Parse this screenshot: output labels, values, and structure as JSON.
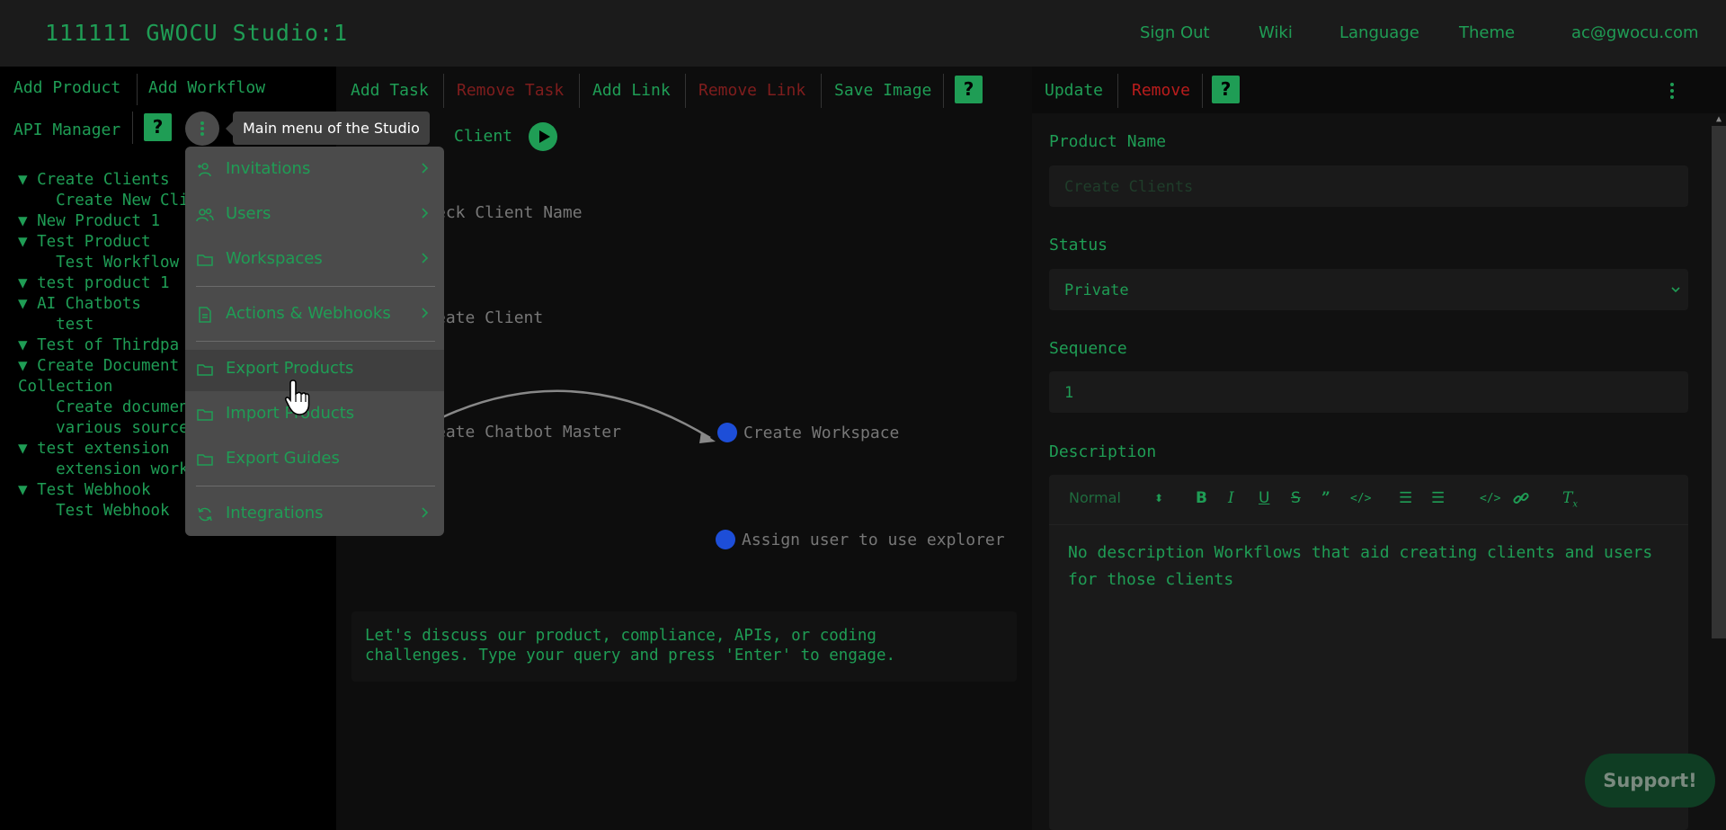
{
  "header": {
    "title": "111111 GWOCU Studio:1",
    "links": [
      "Sign Out",
      "Wiki",
      "Language",
      "Theme",
      "ac@gwocu.com"
    ]
  },
  "left_toolbar": {
    "add_product": "Add Product",
    "add_workflow": "Add Workflow",
    "api_manager": "API Manager",
    "help": "?",
    "menu_tooltip": "Main menu of the Studio"
  },
  "tree": {
    "items": [
      "▼ Create Clients",
      "    Create New Cli",
      "▼ New Product 1",
      "▼ Test Product",
      "    Test Workflow",
      "▼ test product 1",
      "▼ AI Chatbots",
      "    test",
      "▼ Test of Thirdpa",
      "▼ Create Document",
      "Collection",
      "    Create documen",
      "    various source",
      "▼ test extension",
      "    extension work",
      "▼ Test Webhook",
      "    Test Webhook"
    ]
  },
  "main_menu": {
    "items": [
      {
        "label": "Invitations",
        "icon": "user-plus-icon",
        "submenu": true
      },
      {
        "label": "Users",
        "icon": "users-icon",
        "submenu": true
      },
      {
        "label": "Workspaces",
        "icon": "folder-icon",
        "submenu": true
      },
      {
        "label": "Actions & Webhooks",
        "icon": "document-icon",
        "submenu": true
      },
      {
        "label": "Export Products",
        "icon": "folder-icon",
        "submenu": false,
        "hovered": true
      },
      {
        "label": "Import Products",
        "icon": "folder-icon",
        "submenu": false
      },
      {
        "label": "Export Guides",
        "icon": "folder-icon",
        "submenu": false
      },
      {
        "label": "Integrations",
        "icon": "refresh-icon",
        "submenu": true
      }
    ]
  },
  "center_toolbar": {
    "add_task": "Add Task",
    "remove_task": "Remove Task",
    "add_link": "Add Link",
    "remove_link": "Remove Link",
    "save_image": "Save Image",
    "help": "?"
  },
  "canvas": {
    "workflow_title": "Client",
    "nodes": [
      "eck Client Name",
      "eate Client",
      "eate Chatbot Master",
      "Create Workspace",
      "Assign user to use explorer"
    ]
  },
  "chat": {
    "line1": "Let's discuss our product, compliance, APIs, or coding",
    "line2": "challenges. Type your query and press 'Enter' to engage."
  },
  "right_toolbar": {
    "update": "Update",
    "remove": "Remove",
    "help": "?"
  },
  "form": {
    "product_name_label": "Product Name",
    "product_name_placeholder": "Create Clients",
    "status_label": "Status",
    "status_value": "Private",
    "sequence_label": "Sequence",
    "sequence_value": "1",
    "description_label": "Description",
    "format_select": "Normal",
    "description_text": "No description Workflows that aid creating clients and users for those clients"
  },
  "support_button": "Support!",
  "colors": {
    "accent": "#1f9d55",
    "danger": "#b91c1c",
    "menu_bg": "#4b4b4b",
    "node_dot": "#1d4ed8"
  }
}
